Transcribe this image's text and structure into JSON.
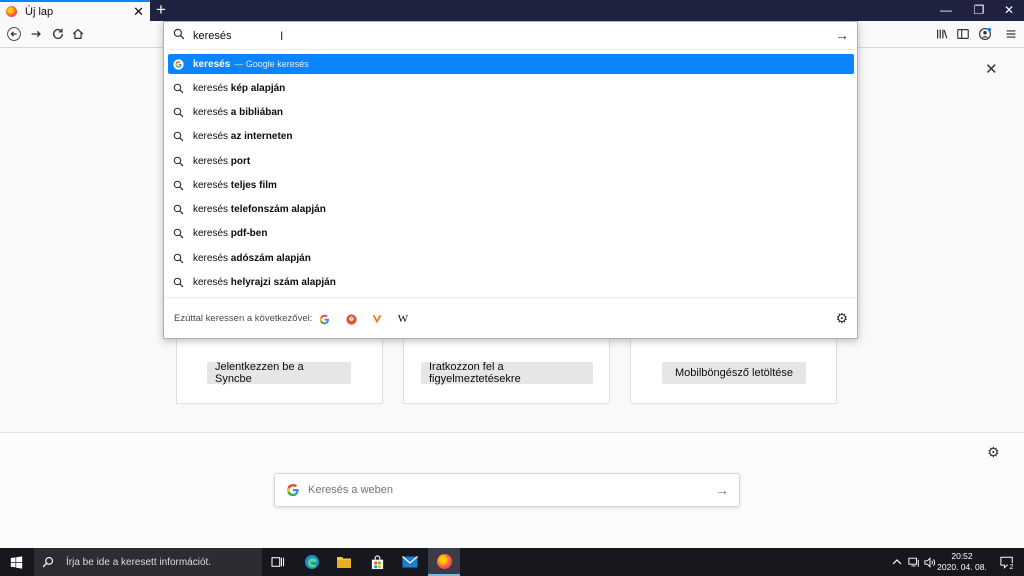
{
  "tab": {
    "title": "Új lap",
    "close": "✕",
    "new": "+"
  },
  "window": {
    "minimize": "—",
    "restore": "❐",
    "close": "✕"
  },
  "urlbar": {
    "value": "keresés"
  },
  "suggestions": [
    {
      "prefix": "keresés",
      "bold": "",
      "engine": "— Google keresés",
      "selected": true
    },
    {
      "prefix": "keresés ",
      "bold": "kép alapján"
    },
    {
      "prefix": "keresés ",
      "bold": "a bibliában"
    },
    {
      "prefix": "keresés ",
      "bold": "az interneten"
    },
    {
      "prefix": "keresés ",
      "bold": "port"
    },
    {
      "prefix": "keresés ",
      "bold": "teljes film"
    },
    {
      "prefix": "keresés ",
      "bold": "telefonszám alapján"
    },
    {
      "prefix": "keresés ",
      "bold": "pdf-ben"
    },
    {
      "prefix": "keresés ",
      "bold": "adószám alapján"
    },
    {
      "prefix": "keresés ",
      "bold": "helyrajzi szám alapján"
    }
  ],
  "oneoff": {
    "label": "Ezúttal keressen a következővel:"
  },
  "cards": {
    "sync": "Jelentkezzen be a Syncbe",
    "alerts": "Iratkozzon fel a figyelmeztetésekre",
    "mobile": "Mobilböngésző letöltése"
  },
  "websearch": {
    "placeholder": "Keresés a weben"
  },
  "taskbar": {
    "search_placeholder": "Írja be ide a keresett információt.",
    "time": "20:52",
    "date": "2020. 04. 08.",
    "notif_count": "2"
  },
  "colors": {
    "accent": "#0a84ff",
    "tabstrip": "#202340",
    "taskbar": "#16181e"
  }
}
